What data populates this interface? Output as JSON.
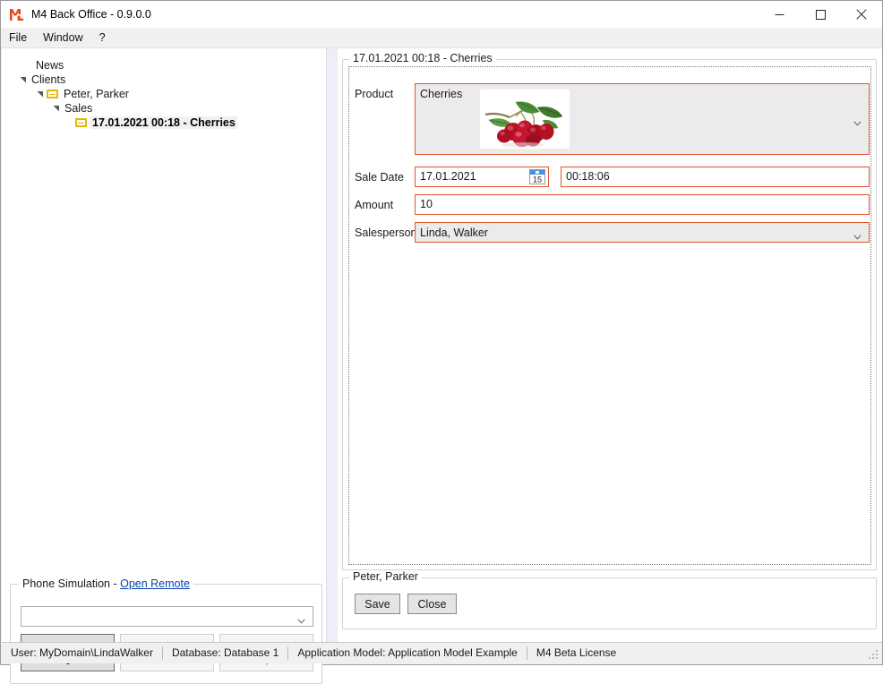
{
  "window": {
    "title": "M4 Back Office - 0.9.0.0",
    "logo_text": "M4",
    "minimize_label": "Minimize",
    "maximize_label": "Maximize",
    "close_label": "Close"
  },
  "menu": {
    "items": [
      {
        "label": "File"
      },
      {
        "label": "Window"
      },
      {
        "label": "?"
      }
    ]
  },
  "tree": {
    "nodes": [
      {
        "label": "News",
        "expander": "",
        "icon": "none",
        "depth": 1,
        "selected": false
      },
      {
        "label": "Clients",
        "expander": "collapse-arrow",
        "icon": "none",
        "depth": 0,
        "selected": false
      },
      {
        "label": "Peter, Parker",
        "expander": "collapse-arrow",
        "icon": "card-icon",
        "depth": 1,
        "selected": false
      },
      {
        "label": "Sales",
        "expander": "collapse-arrow",
        "icon": "none",
        "depth": 2,
        "selected": false
      },
      {
        "label": "17.01.2021 00:18 - Cherries",
        "expander": "",
        "icon": "card-icon",
        "depth": 3,
        "selected": true
      }
    ]
  },
  "phone_simulation": {
    "legend_prefix": "Phone Simulation - ",
    "legend_link": "Open Remote",
    "combo_value": "",
    "combo_placeholder": "",
    "buttons": [
      {
        "name": "dialpad",
        "active": true
      },
      {
        "name": "answer-call",
        "active": false
      },
      {
        "name": "hang-up-call",
        "active": false
      }
    ]
  },
  "detail": {
    "legend": "17.01.2021 00:18 - Cherries",
    "fields": {
      "product_label": "Product",
      "product_value": "Cherries",
      "sale_date_label": "Sale Date",
      "sale_date_value": "17.01.2021",
      "sale_time_value": "00:18:06",
      "calendar_day": "15",
      "amount_label": "Amount",
      "amount_value": "10",
      "salesperson_label": "Salesperson",
      "salesperson_value": "Linda, Walker"
    }
  },
  "actions": {
    "legend": "Peter, Parker",
    "save_label": "Save",
    "close_label": "Close"
  },
  "statusbar": {
    "cells": [
      {
        "text": "User: MyDomain\\LindaWalker"
      },
      {
        "text": "Database: Database 1"
      },
      {
        "text": "Application Model: Application Model Example"
      },
      {
        "text": "M4 Beta License"
      }
    ]
  },
  "colors": {
    "accent_orange": "#e1552a",
    "logo_orange": "#e8481c",
    "link_blue": "#0645ad",
    "tree_icon_gold": "#e8b600",
    "calendar_header_blue": "#4a90d9",
    "answer_green": "#86de86",
    "hangup_red": "#f08080"
  }
}
